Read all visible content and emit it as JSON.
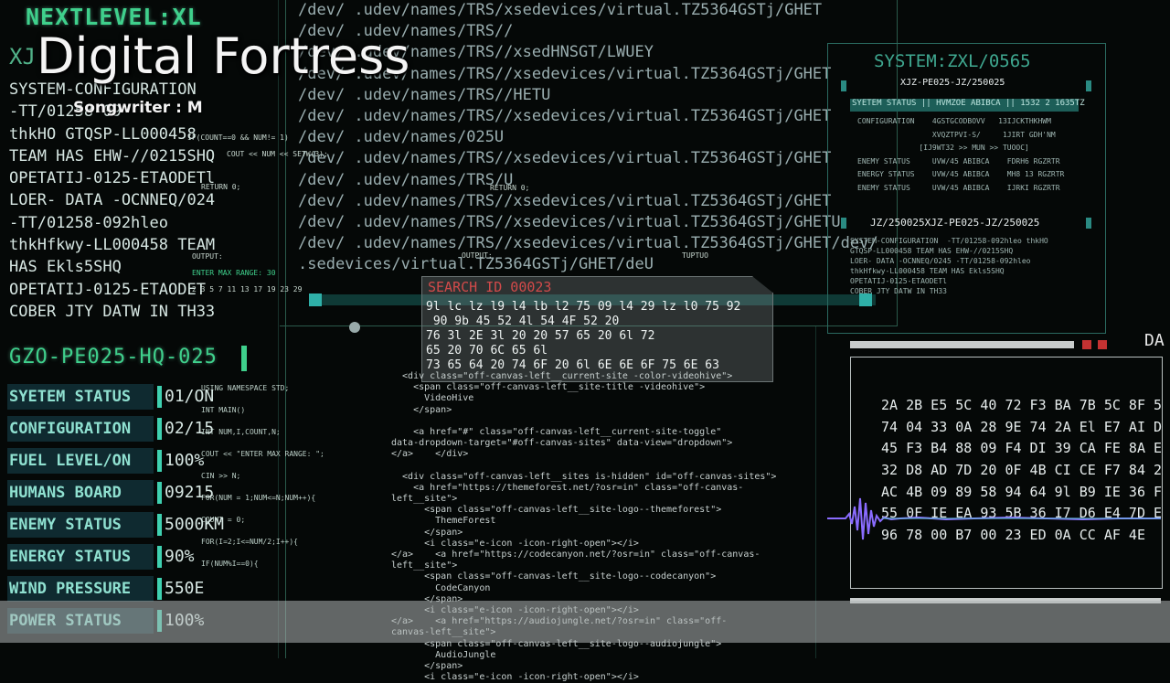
{
  "brand": "NEXTLEVEL:XL",
  "brand_sub": "XJ",
  "title": "Digital Fortress",
  "subtitle": "Songwriter : M",
  "left_lines": [
    "SYSTEM-CONFIGURATION",
    "-TT/01258-09",
    "thkHO GTQSP-LL000458",
    "TEAM HAS EHW-//0215SHQ",
    "OPETATIJ-0125-ETAODETl",
    "LOER- DATA -OCNNEQ/024",
    "-TT/01258-092hleo",
    "thkHfkwy-LL000458 TEAM",
    "HAS Ekls5SHQ",
    "OPETATIJ-0125-ETAODET",
    "COBER JTY DATW IN TH33"
  ],
  "section_code": "GZO-PE025-HQ-025",
  "status_rows": [
    {
      "label": "SYETEM STATUS",
      "value": "01/ON"
    },
    {
      "label": "CONFIGURATION",
      "value": "02/15"
    },
    {
      "label": "FUEL LEVEL/ON",
      "value": "100%"
    },
    {
      "label": "HUMANS BOARD",
      "value": "09215"
    },
    {
      "label": "ENEMY STATUS",
      "value": "5000KM"
    },
    {
      "label": "ENERGY STATUS",
      "value": "90%"
    },
    {
      "label": "WIND PRESSURE",
      "value": "550E"
    },
    {
      "label": "POWER STATUS",
      "value": "100%"
    }
  ],
  "dev_lines": [
    "/dev/ .udev/names/TRS/xsedevices/virtual.TZ5364GSTj/GHET",
    "/dev/ .udev/names/TRS//",
    "/dev/ .udev/names/TRS//xsedHNSGT/LWUEY",
    "/dev/ .udev/names/TRS//xsedevices/virtual.TZ5364GSTj/GHET",
    "/dev/ .udev/names/TRS//HETU",
    "/dev/ .udev/names/TRS//xsedevices/virtual.TZ5364GSTj/GHET",
    "/dev/ .udev/names/025U",
    "/dev/ .udev/names/TRS//xsedevices/virtual.TZ5364GSTj/GHET",
    "/dev/ .udev/names/TRS/U",
    "/dev/ .udev/names/TRS//xsedevices/virtual.TZ5364GSTj/GHET",
    "/dev/ .udev/names/TRS//xsedevices/virtual.TZ5364GSTj/GHETU",
    "/dev/ .udev/names/TRS//xsedevices/virtual.TZ5364GSTj/GHET/dev/",
    ".sedevices/virtual.TZ5364GSTj/GHET/deU"
  ],
  "search": {
    "title": "SEARCH ID 00023",
    "lines": [
      "9l lc lz l9 l4 lb l2 75 09 l4 29 lz l0 75 92",
      " 90 9b 45 52 4l 54 4F 52 20",
      "76 3l 2E 3l 20 20 57 65 20 6l 72",
      "65 20 70 6C 65 6l",
      "73 65 64 20 74 6F 20 6l 6E 6E 6F 75 6E 63"
    ]
  },
  "code_lines": [
    "  <div class=\"off-canvas-left__current-site -color-videohive\">",
    "    <span class=\"off-canvas-left__site-title -videohive\">",
    "      VideoHive",
    "    </span>",
    "",
    "    <a href=\"#\" class=\"off-canvas-left__current-site-toggle\"",
    "data-dropdown-target=\"#off-canvas-sites\" data-view=\"dropdown\">",
    "</a>    </div>",
    "",
    "  <div class=\"off-canvas-left__sites is-hidden\" id=\"off-canvas-sites\">",
    "    <a href=\"https://themeforest.net/?osr=in\" class=\"off-canvas-",
    "left__site\">",
    "      <span class=\"off-canvas-left__site-logo--themeforest\">",
    "        ThemeForest",
    "      </span>",
    "      <i class=\"e-icon -icon-right-open\"></i>",
    "</a>    <a href=\"https://codecanyon.net/?osr=in\" class=\"off-canvas-",
    "left__site\">",
    "      <span class=\"off-canvas-left__site-logo--codecanyon\">",
    "        CodeCanyon",
    "      </span>",
    "      <i class=\"e-icon -icon-right-open\"></i>",
    "</a>    <a href=\"https://audiojungle.net/?osr=in\" class=\"off-",
    "canvas-left__site\">",
    "      <span class=\"off-canvas-left__site-logo--audiojungle\">",
    "        AudioJungle",
    "      </span>",
    "      <i class=\"e-icon -icon-right-open\"></i>"
  ],
  "code_annotations": [
    "USING NAMESPACE STD;",
    "INT MAIN()",
    "INT NUM,I,COUNT,N;",
    "COUT << \"ENTER MAX RANGE: \";",
    "CIN >> N;",
    "FOR(NUM = 1;NUM<=N;NUM++){",
    "COUNT = 0;",
    "FOR(I=2;I<=NUM/2;I++){",
    "IF(NUM%I==0){"
  ],
  "small_overlays": {
    "if_count": "IF(COUNT==0 && NUM!= 1)",
    "cout_num": "COUT << NUM << SETW(3);",
    "return0": "RETURN 0;",
    "output": "OUTPUT:",
    "enter_max": "ENTER MAX RANGE: 30",
    "primes": "2 3 5 7 11 13 17 19 23 29",
    "return0_b": "RETURN 0;",
    "output_b": "OUTPUT:",
    "tuptuo": "TUPTUO"
  },
  "system_panel": {
    "title": "SYSTEM:ZXL/0565",
    "sub": "XJZ-PE025-JZ/250025",
    "header": "SYETEM STATUS  || HVMZOE ABIBCA  ||  1532 2 1635TZ",
    "rows": [
      "CONFIGURATION    4GSTGCODBOVV   13IJCKTHKHWM",
      "                 XVQZTPVI-S/     1JIRT GDH'NM",
      "              [IJ9WT32 >> MUN >> TUOOC]",
      "ENEMY STATUS     UVW/45 ABIBCA    FDRH6 RGZRTR",
      "ENERGY STATUS    UVW/45 ABIBCA    MH8 13 RGZRTR",
      "ENEMY STATUS     UVW/45 ABIBCA    IJRKI RGZRTR"
    ],
    "title2": "JZ/250025XJZ-PE025-JZ/250025",
    "rows2": [
      "SYSTEM-CONFIGURATION  -TT/01258-092hleo thkHO",
      "GTQSP-LL000458 TEAM HAS EHW-//0215SHQ",
      "LOER- DATA -OCNNEQ/0245 -TT/01258-092hleo",
      "thkHfkwy-LL000458 TEAM HAS Ekls5SHQ",
      "OPETATIJ-0125-ETAODETl",
      "COBER JTY DATW IN TH33"
    ]
  },
  "hex_panel": {
    "label": "DA",
    "lines": [
      "2A 2B E5 5C 40 72 F3 BA 7B 5C 8F 5",
      "74 04 33 0A 28 9E 74 2A El E7 AI D",
      "45 F3 B4 88 09 F4 DI 39 CA FE 8A E",
      "32 D8 AD 7D 20 0F 4B CI CE F7 84 2",
      "AC 4B 09 89 58 94 64 9l B9 IE 36 F",
      "55 0F IE EA 93 5B 36 I7 D6 E4 7D E",
      "96 78 00 B7 00 23 ED 0A CC AF 4E"
    ]
  },
  "colors": {
    "accent_green": "#3fd08c",
    "accent_teal": "#3fd0b0",
    "panel_label_bg": "#0f2a30",
    "search_red": "#d24a4a",
    "waveform": "#8a6cff"
  }
}
